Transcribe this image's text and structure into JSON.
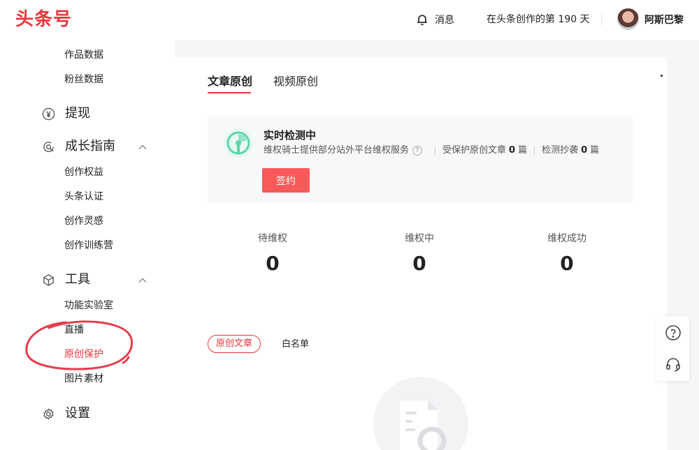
{
  "header": {
    "logo": "头条号",
    "messages_label": "消息",
    "days_text": "在头条创作的第 190 天",
    "username": "阿斯巴黎"
  },
  "sidebar": {
    "top_items": [
      "作品数据",
      "粉丝数据"
    ],
    "withdraw_label": "提现",
    "growth": {
      "label": "成长指南",
      "items": [
        "创作权益",
        "头条认证",
        "创作灵感",
        "创作训练营"
      ]
    },
    "tools": {
      "label": "工具",
      "items": [
        "功能实验室",
        "直播",
        "原创保护",
        "图片素材"
      ],
      "active_item": "原创保护"
    },
    "settings_label": "设置"
  },
  "main": {
    "tabs": [
      {
        "label": "文章原创",
        "active": true
      },
      {
        "label": "视频原创",
        "active": false
      }
    ],
    "card": {
      "title": "实时检测中",
      "desc_service": "维权骑士提供部分站外平台维权服务",
      "desc_protected_prefix": "受保护原创文章",
      "desc_protected_count": "0",
      "desc_protected_unit": "篇",
      "desc_copy_prefix": "检测抄袭",
      "desc_copy_count": "0",
      "desc_copy_unit": "篇",
      "sign_button": "签约"
    },
    "stats": [
      {
        "label": "待维权",
        "value": "0"
      },
      {
        "label": "维权中",
        "value": "0"
      },
      {
        "label": "维权成功",
        "value": "0"
      }
    ],
    "filter": {
      "original_label": "原创文章",
      "whitelist_label": "白名单"
    }
  },
  "colors": {
    "brand": "#e8363d",
    "button": "#f85959",
    "annotation": "#e53d4d",
    "radar_green": "#5ed4a8"
  },
  "icons": {
    "messages": "bell-icon",
    "withdraw": "yen-icon",
    "growth": "growth-icon",
    "tools": "cube-icon",
    "settings": "gear-icon",
    "float_help": "question-icon",
    "float_service": "headset-icon"
  }
}
